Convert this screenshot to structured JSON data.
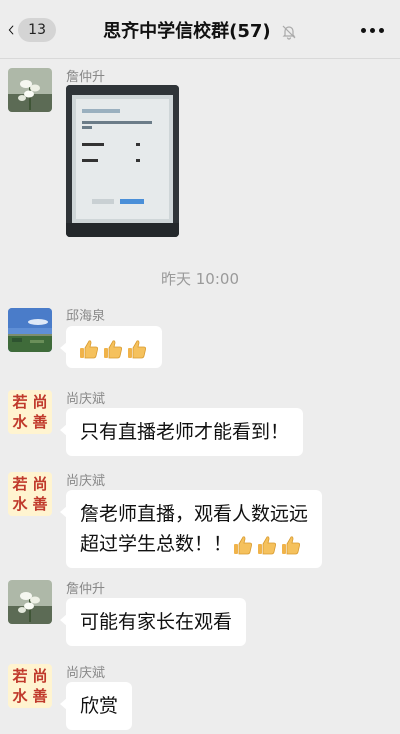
{
  "header": {
    "back_badge": "13",
    "title": "思齐中学信校群(57)"
  },
  "seal": {
    "c1": "若",
    "c2": "尚",
    "c3": "水",
    "c4": "善"
  },
  "timestamp": "昨天 10:00",
  "messages": [
    {
      "sender": "詹仲升",
      "type": "image"
    },
    {
      "sender": "邱海泉",
      "type": "emoji",
      "emoji": "thumbs-up",
      "count": 3
    },
    {
      "sender": "尚庆斌",
      "text": "只有直播老师才能看到！"
    },
    {
      "sender": "尚庆斌",
      "line1": "詹老师直播，观看人数远远",
      "line2": "超过学生总数！！"
    },
    {
      "sender": "詹仲升",
      "text": "可能有家长在观看"
    },
    {
      "sender": "尚庆斌",
      "text": "欣赏"
    }
  ]
}
